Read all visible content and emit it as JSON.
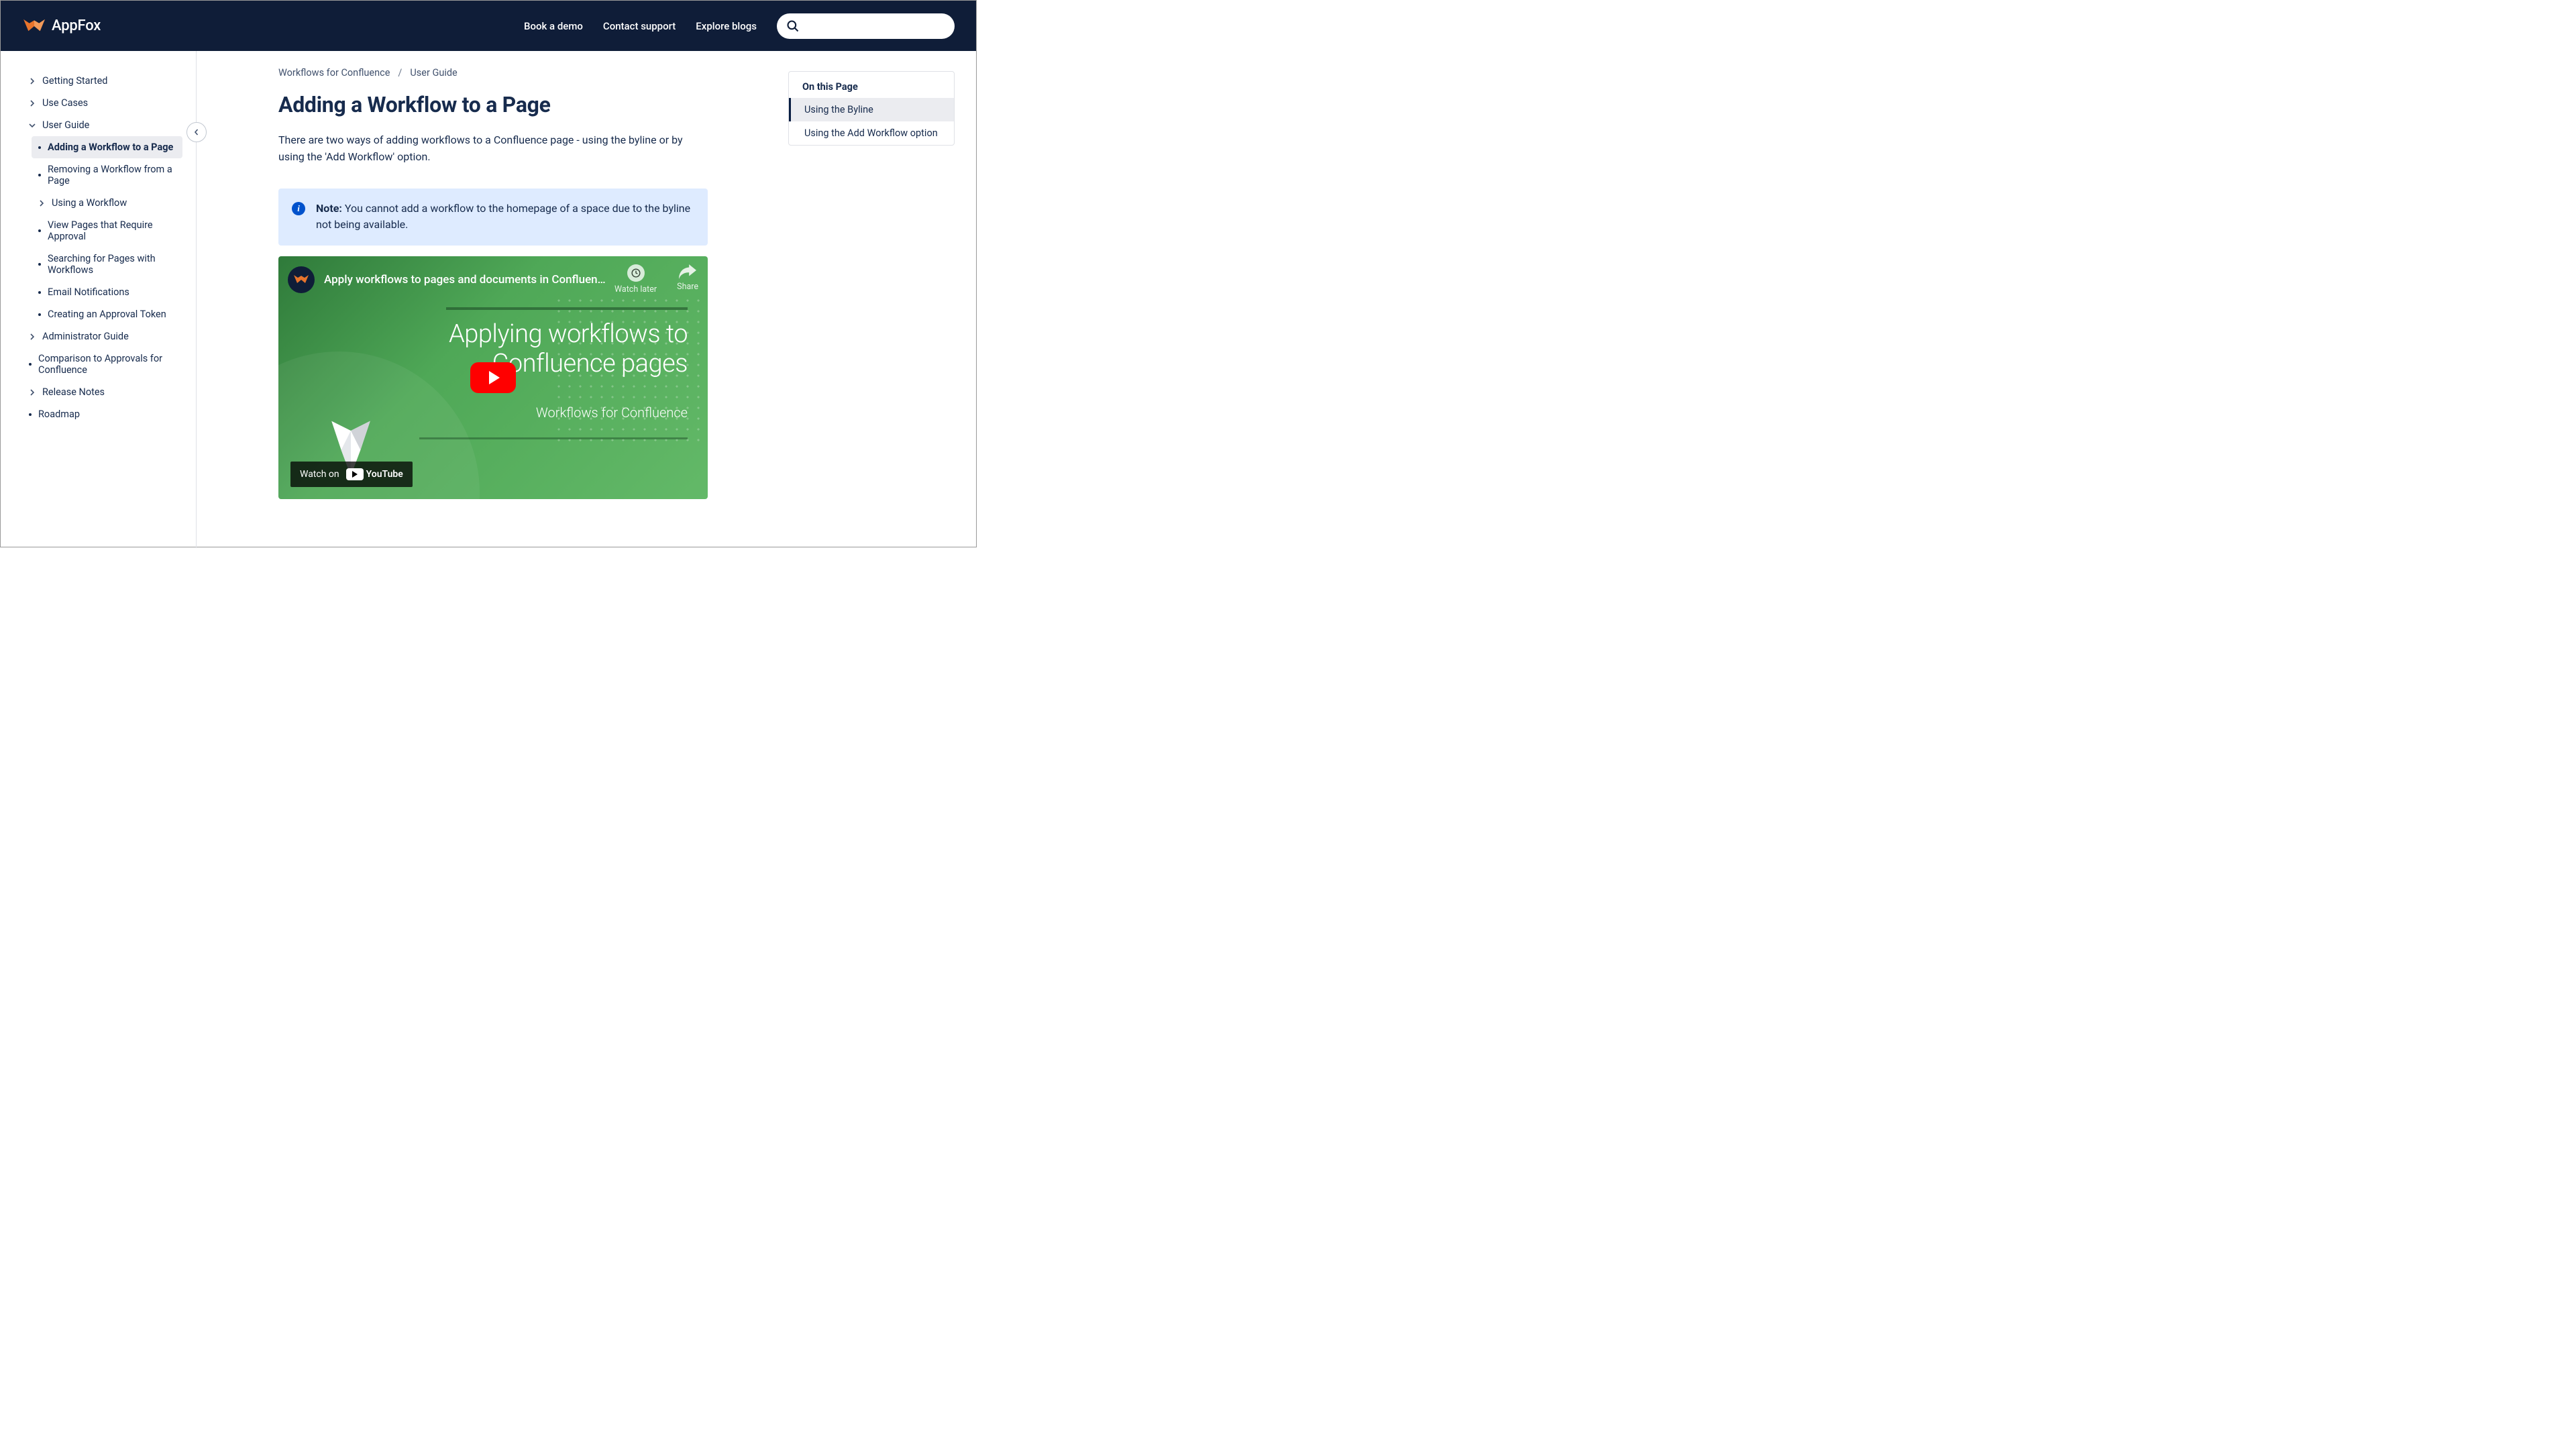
{
  "header": {
    "brand": "AppFox",
    "links": [
      "Book a demo",
      "Contact support",
      "Explore blogs"
    ],
    "search_placeholder": ""
  },
  "sidebar": {
    "items": [
      {
        "label": "Getting Started",
        "expandable": true
      },
      {
        "label": "Use Cases",
        "expandable": true
      },
      {
        "label": "User Guide",
        "expandable": true,
        "open": true,
        "children": [
          {
            "label": "Adding a Workflow to a Page",
            "active": true
          },
          {
            "label": "Removing a Workflow from a Page"
          },
          {
            "label": "Using a Workflow",
            "expandable": true
          },
          {
            "label": "View Pages that Require Approval"
          },
          {
            "label": "Searching for Pages with Workflows"
          },
          {
            "label": "Email Notifications"
          },
          {
            "label": "Creating an Approval Token"
          }
        ]
      },
      {
        "label": "Administrator Guide",
        "expandable": true
      },
      {
        "label": "Comparison to Approvals for Confluence"
      },
      {
        "label": "Release Notes",
        "expandable": true
      },
      {
        "label": "Roadmap"
      }
    ]
  },
  "breadcrumb": [
    "Workflows for Confluence",
    "User Guide"
  ],
  "page": {
    "title": "Adding a Workflow to a Page",
    "intro": "There are two ways of adding workflows to a Confluence page - using the byline or by using the 'Add Workflow' option.",
    "note_label": "Note:",
    "note_text": "You cannot add a workflow to the homepage of a space due to the byline not being available."
  },
  "video": {
    "title": "Apply workflows to pages and documents in Confluen…",
    "watch_later": "Watch later",
    "share": "Share",
    "overlay_line1": "Applying workflows to",
    "overlay_line2": "Confluence pages",
    "overlay_sub": "Workflows for Confluence",
    "watch_on": "Watch on",
    "youtube": "YouTube"
  },
  "toc": {
    "title": "On this Page",
    "items": [
      {
        "label": "Using the Byline",
        "active": true
      },
      {
        "label": "Using the Add Workflow option"
      }
    ]
  }
}
